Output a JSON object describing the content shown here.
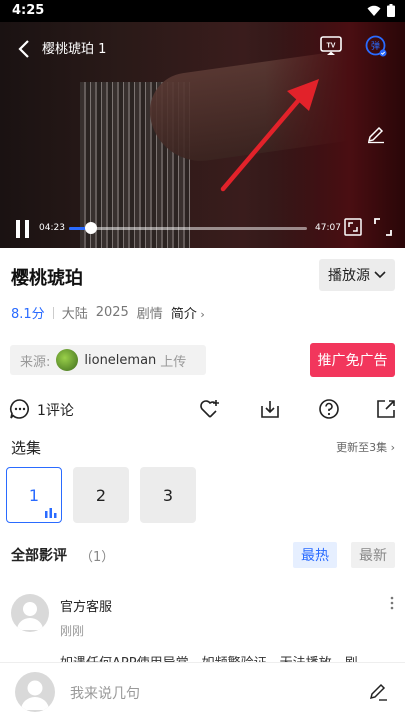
{
  "status": {
    "time": "4:25"
  },
  "player": {
    "title": "樱桃琥珀 1",
    "current_time": "04:23",
    "total_time": "47:07",
    "progress": 0.093
  },
  "info": {
    "title": "樱桃琥珀",
    "source_button": "播放源",
    "score": "8.1分",
    "region": "大陆",
    "year": "2025",
    "genre": "剧情",
    "intro": "简介"
  },
  "uploader": {
    "label": "来源:",
    "name": "lioneleman",
    "suffix": "上传"
  },
  "ad_button": "推广免广告",
  "actions": {
    "comment_count": "1评论"
  },
  "episodes": {
    "header": "选集",
    "update": "更新至3集",
    "items": [
      "1",
      "2",
      "3"
    ]
  },
  "reviews": {
    "header": "全部影评",
    "count": "（1）",
    "sort_hot": "最热",
    "sort_new": "最新"
  },
  "comment": {
    "name": "官方客服",
    "time": "刚刚",
    "text": "如遇任何APP使用异常，如频繁验证，无法播放，刷"
  },
  "bottom": {
    "placeholder": "我来说几句"
  },
  "colors": {
    "accent": "#2a6bff",
    "ad": "#f2365c",
    "arrow": "#e2222a"
  }
}
